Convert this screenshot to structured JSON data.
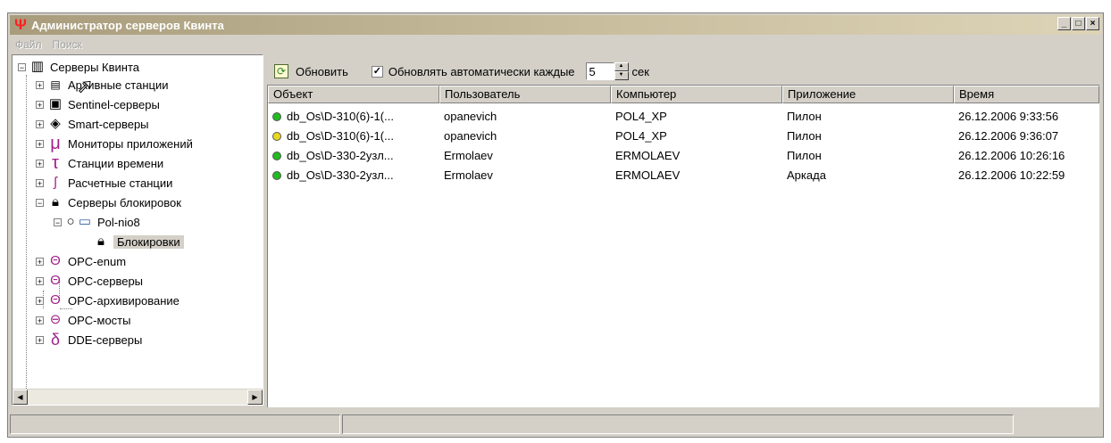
{
  "window": {
    "title": "Администратор серверов Квинта",
    "app_icon": "Ψ",
    "controls": [
      "_",
      "□",
      "×"
    ],
    "accent": "#ff2020"
  },
  "menu": [
    "Файл",
    "Поиск"
  ],
  "tree": {
    "root": "Серверы Квинта",
    "items": [
      {
        "label": "Архивные станции",
        "icon": "archive-icon"
      },
      {
        "label": "Sentinel-серверы",
        "icon": "sentinel-icon"
      },
      {
        "label": "Smart-серверы",
        "icon": "smart-icon"
      },
      {
        "label": "Мониторы приложений",
        "icon": "mu-icon"
      },
      {
        "label": "Станции времени",
        "icon": "tau-icon"
      },
      {
        "label": "Расчетные станции",
        "icon": "calc-icon"
      },
      {
        "label": "Серверы блокировок",
        "icon": "lock-icon"
      },
      {
        "label": "Pol-nio8",
        "icon": "computer-icon"
      },
      {
        "label": "Блокировки",
        "icon": "lock-icon"
      },
      {
        "label": "OPC-enum",
        "icon": "theta-icon"
      },
      {
        "label": "OPC-серверы",
        "icon": "theta-icon"
      },
      {
        "label": "OPC-архивирование",
        "icon": "theta-icon"
      },
      {
        "label": "OPC-мосты",
        "icon": "bridge-icon"
      },
      {
        "label": "DDE-серверы",
        "icon": "delta-icon"
      }
    ]
  },
  "toolbar": {
    "refresh_label": "Обновить",
    "auto_refresh_label": "Обновлять автоматически каждые",
    "interval_value": "5",
    "unit": "сек"
  },
  "table": {
    "columns": [
      "Объект",
      "Пользователь",
      "Компьютер",
      "Приложение",
      "Время"
    ],
    "rows": [
      {
        "status": "#22bb22",
        "cells": [
          "db_Os\\D-310(6)-1(...",
          "opanevich",
          "POL4_XP",
          "Пилон",
          "26.12.2006 9:33:56"
        ]
      },
      {
        "status": "#e8d820",
        "cells": [
          "db_Os\\D-310(6)-1(...",
          "opanevich",
          "POL4_XP",
          "Пилон",
          "26.12.2006 9:36:07"
        ]
      },
      {
        "status": "#22bb22",
        "cells": [
          "db_Os\\D-330-2узл...",
          "Ermolaev",
          "ERMOLAEV",
          "Пилон",
          "26.12.2006 10:26:16"
        ]
      },
      {
        "status": "#22bb22",
        "cells": [
          "db_Os\\D-330-2узл...",
          "Ermolaev",
          "ERMOLAEV",
          "Аркада",
          "26.12.2006 10:22:59"
        ]
      }
    ]
  }
}
